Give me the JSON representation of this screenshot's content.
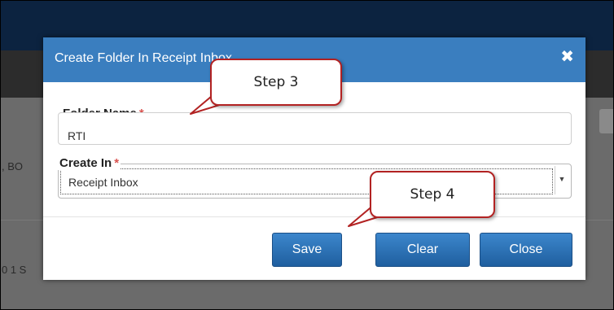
{
  "background": {
    "row1_text": ", BO",
    "row2_text": "0 1 S"
  },
  "dialog": {
    "title": "Create Folder In Receipt Inbox",
    "close_glyph": "✖",
    "folder_name": {
      "label": "Folder Name",
      "required_mark": "*",
      "value": "RTI"
    },
    "create_in": {
      "label": "Create In",
      "required_mark": "*",
      "selected": "Receipt Inbox",
      "caret_glyph": "▼"
    },
    "buttons": {
      "save": "Save",
      "clear": "Clear",
      "close": "Close"
    }
  },
  "annotations": {
    "step3": "Step 3",
    "step4": "Step 4"
  },
  "colors": {
    "header_blue": "#3a7ebf",
    "button_blue": "#2a6fb3",
    "required_red": "#d9534f",
    "callout_border": "#b22222"
  }
}
